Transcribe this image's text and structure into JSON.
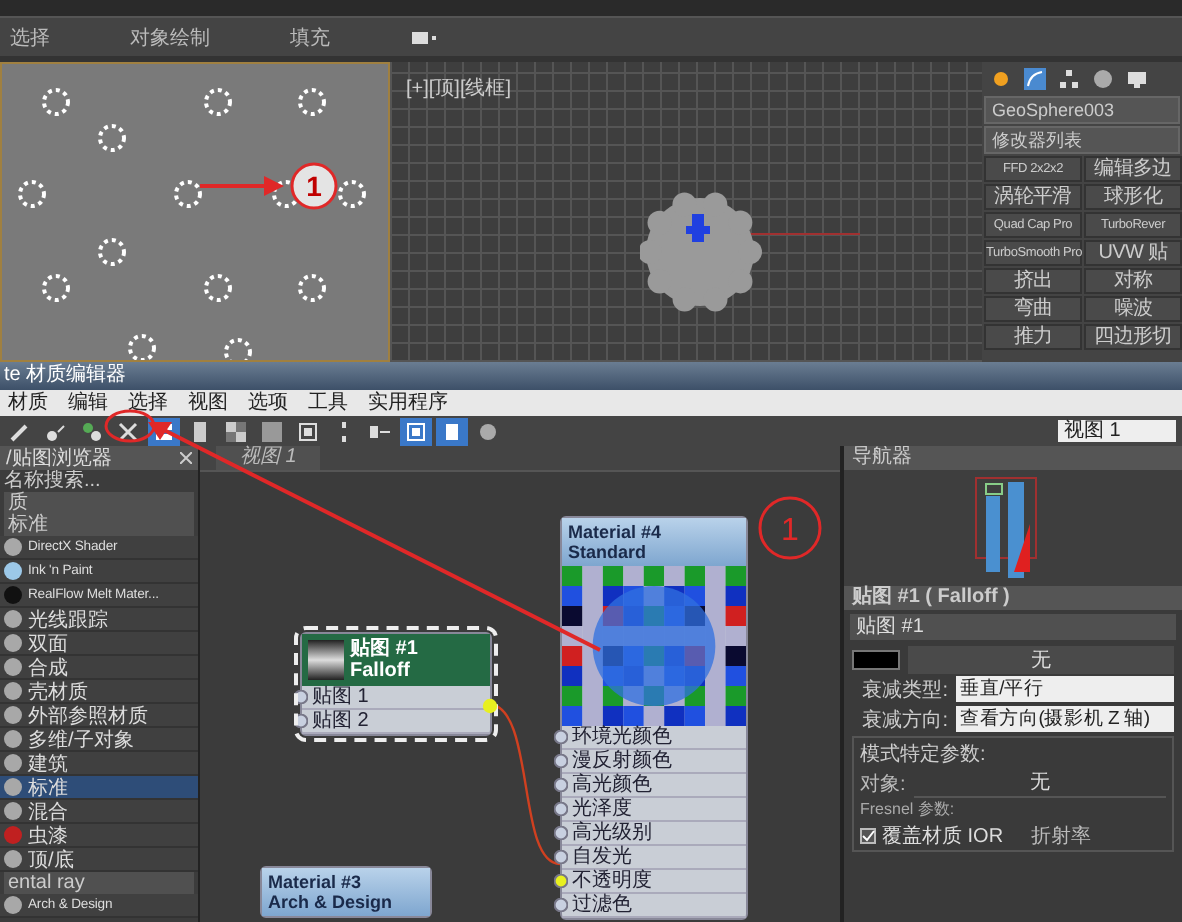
{
  "ribbon": {
    "labels": [
      "选择",
      "对象绘制",
      "填充"
    ]
  },
  "viewport_top": {
    "label": "[+][顶][线框]"
  },
  "command_panel": {
    "object_name": "GeoSphere003",
    "modifier_list": "修改器列表",
    "modifiers": [
      "FFD 2x2x2",
      "编辑多边",
      "涡轮平滑",
      "球形化",
      "Quad Cap Pro",
      "TurboRever",
      "TurboSmooth Pro",
      "UVW 贴",
      "挤出",
      "对称",
      "弯曲",
      "噪波",
      "推力",
      "四边形切"
    ]
  },
  "material_editor": {
    "title": "te 材质编辑器",
    "menu": [
      "材质",
      "编辑",
      "选择",
      "视图",
      "选项",
      "工具",
      "实用程序"
    ],
    "toolbar": [
      {
        "kind": "picker",
        "on": false
      },
      {
        "kind": "put",
        "on": false
      },
      {
        "kind": "assign",
        "on": false
      },
      {
        "kind": "delete",
        "on": false
      },
      {
        "kind": "move",
        "on": true
      },
      {
        "kind": "layout",
        "on": false
      },
      {
        "kind": "checker",
        "on": false
      },
      {
        "kind": "background",
        "on": false
      },
      {
        "kind": "select",
        "on": false
      },
      {
        "kind": "arrange",
        "on": false
      },
      {
        "kind": "hide",
        "on": false
      },
      {
        "kind": "show-map",
        "on": true
      },
      {
        "kind": "show-end",
        "on": true
      },
      {
        "kind": "zoom",
        "on": false
      }
    ],
    "view_selector": "视图 1"
  },
  "browser": {
    "title": "/贴图浏览器",
    "search_placeholder": "名称搜索...",
    "rows": [
      {
        "kind": "category",
        "label": "质"
      },
      {
        "kind": "category",
        "label": "标准"
      },
      {
        "kind": "item",
        "label": "DirectX Shader",
        "color": "#a8a8a8",
        "selected": false
      },
      {
        "kind": "item",
        "label": "Ink 'n Paint",
        "color": "#9cc8e8",
        "selected": false
      },
      {
        "kind": "item",
        "label": "RealFlow Melt Mater...",
        "color": "#111111",
        "selected": false
      },
      {
        "kind": "item",
        "label": "光线跟踪",
        "color": "#a8a8a8",
        "selected": false
      },
      {
        "kind": "item",
        "label": "双面",
        "color": "#a8a8a8",
        "selected": false
      },
      {
        "kind": "item",
        "label": "合成",
        "color": "#a8a8a8",
        "selected": false
      },
      {
        "kind": "item",
        "label": "壳材质",
        "color": "#a8a8a8",
        "selected": false
      },
      {
        "kind": "item",
        "label": "外部参照材质",
        "color": "#a8a8a8",
        "selected": false
      },
      {
        "kind": "item",
        "label": "多维/子对象",
        "color": "#a8a8a8",
        "selected": false
      },
      {
        "kind": "item",
        "label": "建筑",
        "color": "#a8a8a8",
        "selected": false
      },
      {
        "kind": "item",
        "label": "标准",
        "color": "#a8a8a8",
        "selected": true
      },
      {
        "kind": "item",
        "label": "混合",
        "color": "#a8a8a8",
        "selected": false
      },
      {
        "kind": "item",
        "label": "虫漆",
        "color": "#c02020",
        "selected": false
      },
      {
        "kind": "item",
        "label": "顶/底",
        "color": "#a8a8a8",
        "selected": false
      },
      {
        "kind": "category",
        "label": "ental ray"
      },
      {
        "kind": "item",
        "label": "Arch & Design",
        "color": "#a8a8a8",
        "selected": false
      }
    ]
  },
  "canvas": {
    "tab": "视图 1",
    "nodes": [
      {
        "kind": "map",
        "title": "贴图 #1",
        "subtitle": "Falloff",
        "selected": true,
        "preview": false,
        "slots": [
          {
            "label": "贴图 1",
            "connected": false
          },
          {
            "label": "贴图 2",
            "connected": false
          }
        ]
      },
      {
        "kind": "material",
        "title": "Material #3",
        "subtitle": "Arch & Design",
        "selected": false,
        "preview": false
      },
      {
        "kind": "material",
        "title": "Material #4",
        "subtitle": "Standard",
        "selected": false,
        "preview": true,
        "slots": [
          {
            "label": "环境光颜色",
            "connected": false
          },
          {
            "label": "漫反射颜色",
            "connected": false
          },
          {
            "label": "高光颜色",
            "connected": false
          },
          {
            "label": "光泽度",
            "connected": false
          },
          {
            "label": "高光级别",
            "connected": false
          },
          {
            "label": "自发光",
            "connected": false
          },
          {
            "label": "不透明度",
            "connected": true
          },
          {
            "label": "过滤色",
            "connected": false
          }
        ]
      }
    ]
  },
  "navigator": {
    "title": "导航器"
  },
  "parameters": {
    "title": "贴图 #1 ( Falloff )",
    "name": "贴图 #1",
    "map_slot": "无",
    "falloff_type_label": "衰减类型:",
    "falloff_type": "垂直/平行",
    "falloff_dir_label": "衰减方向:",
    "falloff_dir": "查看方向(摄影机 Z 轴)",
    "group_title": "模式特定参数:",
    "object_label": "对象:",
    "object_value": "无",
    "fresnel_label": "Fresnel 参数:",
    "override_ior": {
      "label": "覆盖材质 IOR",
      "checked": true
    },
    "ior_label": "折射率"
  },
  "annotations": [
    {
      "text": "1"
    },
    {
      "text": "1"
    }
  ]
}
